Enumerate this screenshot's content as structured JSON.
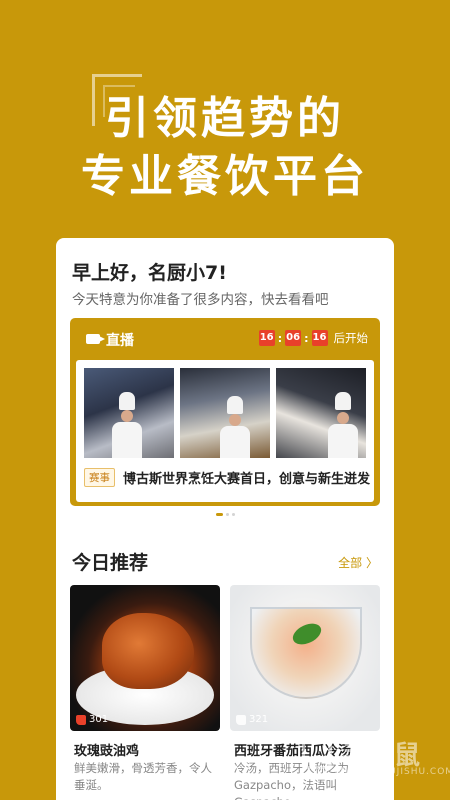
{
  "hero": {
    "line1": "引领趋势的",
    "line2": "专业餐饮平台"
  },
  "greeting": {
    "title": "早上好，名厨小7!",
    "subtitle": "今天特意为你准备了很多内容，快去看看吧"
  },
  "live": {
    "title": "直播",
    "timer": {
      "h": "16",
      "m": "06",
      "s": "16",
      "suffix": "后开始"
    },
    "event_tag": "赛事",
    "event_text": "博古斯世界烹饪大赛首日，创意与新生迸发",
    "carousel": {
      "total": 3,
      "active_index": 0
    }
  },
  "recommend": {
    "title": "今日推荐",
    "see_all": "全部 〉",
    "items": [
      {
        "name": "玫瑰豉油鸡",
        "desc": "鲜美嫩滑，骨透芳香，令人垂涎。",
        "likes": "301"
      },
      {
        "name": "西班牙番茄西瓜冷汤",
        "desc": "冷汤，西班牙人称之为Gazpacho，法语叫Gaspacho",
        "likes": "321"
      }
    ]
  },
  "watermark": {
    "text": "手机鼠",
    "url": "WWW.SHOUJISHU.COM"
  },
  "colors": {
    "brand": "#C8980A",
    "timer": "#E8412A",
    "white": "#FFFFFF"
  },
  "icons": {
    "live": "video-camera-icon",
    "like": "thumbs-up-icon",
    "see_all": "chevron-right-icon"
  }
}
